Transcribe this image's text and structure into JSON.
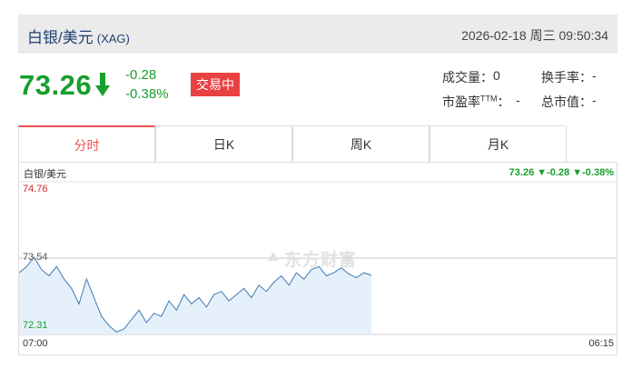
{
  "header": {
    "title": "白银/美元",
    "code": "(XAG)",
    "datetime": "2026-02-18 周三 09:50:34"
  },
  "quote": {
    "price": "73.26",
    "change": "-0.28",
    "change_pct": "-0.38%",
    "status": "交易中"
  },
  "stats": {
    "volume_label": "成交量：",
    "volume_value": "0",
    "turnover_label": "换手率：",
    "turnover_value": "-",
    "pe_label": "市盈率",
    "pe_sup": "TTM",
    "pe_colon": "：",
    "pe_value": "-",
    "mktcap_label": "总市值：",
    "mktcap_value": "-"
  },
  "tabs": [
    "分时",
    "日K",
    "周K",
    "月K"
  ],
  "colors": {
    "down": "#169f2c",
    "up": "#d6262b",
    "accent": "#e8524f",
    "line": "#3f79b5"
  },
  "chart": {
    "name": "白银/美元",
    "quote_line": "73.26 ▼-0.28 ▼-0.38%",
    "y_max_label": "74.76",
    "y_mid_label": "73.54",
    "y_min_label": "72.31",
    "x_start_label": "07:00",
    "x_end_label": "06:15",
    "watermark": "东方财富"
  },
  "chart_data": {
    "type": "area",
    "ylim": [
      72.31,
      74.76
    ],
    "reference": 73.54,
    "x": [
      0,
      1,
      2,
      3,
      4,
      5,
      6,
      7,
      8,
      9,
      10,
      11,
      12,
      13,
      14,
      15,
      16,
      17,
      18,
      19,
      20,
      21,
      22,
      23,
      24,
      25,
      26,
      27,
      28,
      29,
      30,
      31,
      32,
      33,
      34,
      35,
      36,
      37,
      38,
      39,
      40,
      41,
      42,
      43,
      44,
      45,
      46,
      47
    ],
    "values": [
      73.3,
      73.4,
      73.55,
      73.35,
      73.25,
      73.4,
      73.2,
      73.05,
      72.8,
      73.2,
      72.9,
      72.6,
      72.45,
      72.35,
      72.4,
      72.55,
      72.7,
      72.5,
      72.65,
      72.6,
      72.85,
      72.7,
      72.95,
      72.8,
      72.9,
      72.75,
      72.95,
      73.0,
      72.85,
      72.95,
      73.05,
      72.9,
      73.1,
      73.0,
      73.15,
      73.25,
      73.1,
      73.3,
      73.2,
      73.35,
      73.4,
      73.25,
      73.3,
      73.38,
      73.28,
      73.22,
      73.3,
      73.26
    ],
    "total_points": 1395
  }
}
